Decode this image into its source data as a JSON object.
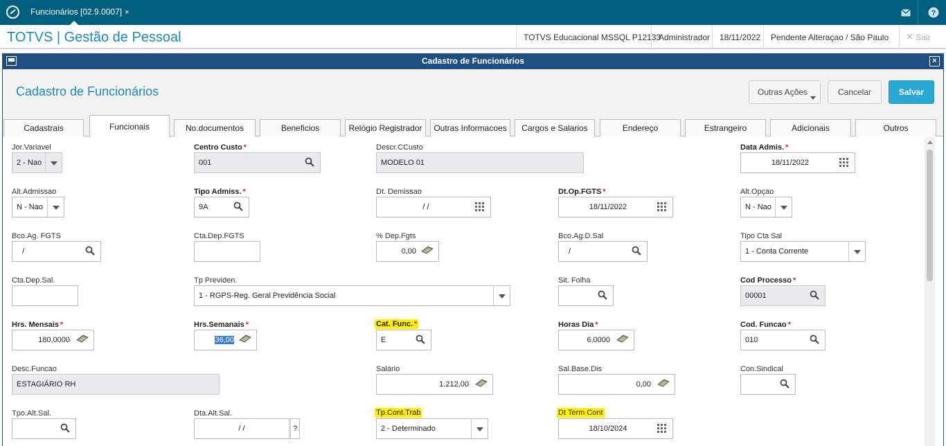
{
  "topbar": {
    "tab_label": "Funcionários [02.9.0007]",
    "tab_close": "×"
  },
  "header": {
    "app_title": "TOTVS | Gestão de Pessoal",
    "environment": "TOTVS Educacional MSSQL P12133",
    "user": "Administrador",
    "date": "18/11/2022",
    "branch": "Pendente Alteraçao / São Paulo",
    "exit_label": "Sair",
    "exit_icon": "×"
  },
  "window": {
    "title": "Cadastro de Funcionários",
    "close": "×"
  },
  "page": {
    "title": "Cadastro de Funcionários",
    "actions_label": "Outras Ações",
    "cancel_label": "Cancelar",
    "save_label": "Salvar"
  },
  "tabs": [
    {
      "label": "Cadastrais"
    },
    {
      "label": "Funcionais"
    },
    {
      "label": "No.documentos"
    },
    {
      "label": "Beneficios"
    },
    {
      "label": "Relógio Registrador"
    },
    {
      "label": "Outras Informacoes"
    },
    {
      "label": "Cargos e Salarios"
    },
    {
      "label": "Endereço"
    },
    {
      "label": "Estrangeiro"
    },
    {
      "label": "Adicionais"
    },
    {
      "label": "Outros"
    }
  ],
  "fields": {
    "jor_variavel": {
      "label": "Jor.Variavel",
      "value": "2 - Nao"
    },
    "centro_custo": {
      "label": "Centro Custo",
      "value": "001"
    },
    "descr_ccusto": {
      "label": "Descr.CCusto",
      "value": "MODELO 01"
    },
    "data_admis": {
      "label": "Data Admis.",
      "value": "18/11/2022"
    },
    "alt_admissao": {
      "label": "Alt.Admissao",
      "value": "N - Nao"
    },
    "tipo_admiss": {
      "label": "Tipo Admiss.",
      "value": "9A"
    },
    "dt_demissao": {
      "label": "Dt. Demissao",
      "value": "/ /"
    },
    "dt_op_fgts": {
      "label": "Dt.Op.FGTS",
      "value": "18/11/2022"
    },
    "alt_opcao": {
      "label": "Alt.Opçao",
      "value": "N - Nao"
    },
    "bco_ag_fgts": {
      "label": "Bco.Ag. FGTS",
      "value": "/"
    },
    "cta_dep_fgts": {
      "label": "Cta.Dep.FGTS",
      "value": ""
    },
    "pct_dep_fgts": {
      "label": "% Dep.Fgts",
      "value": "0,00"
    },
    "bco_ag_d_sal": {
      "label": "Bco.Ag.D.Sal",
      "value": "/"
    },
    "tipo_cta_sal": {
      "label": "Tipo Cta Sal",
      "value": "1 - Conta Corrente"
    },
    "cta_dep_sal": {
      "label": "Cta.Dep.Sal.",
      "value": ""
    },
    "tp_previden": {
      "label": "Tp Previden.",
      "value": "1 - RGPS-Reg. Geral Previdência Social"
    },
    "sit_folha": {
      "label": "Sit. Folha",
      "value": ""
    },
    "cod_processo": {
      "label": "Cod Processo",
      "value": "00001"
    },
    "hrs_mensais": {
      "label": "Hrs. Mensais",
      "value": "180,0000"
    },
    "hrs_semanais": {
      "label": "Hrs.Semanais",
      "value": "36,00"
    },
    "cat_func": {
      "label": "Cat. Func.",
      "value": "E"
    },
    "horas_dia": {
      "label": "Horas Dia",
      "value": "6,0000"
    },
    "cod_funcao": {
      "label": "Cod. Funcao",
      "value": "010"
    },
    "desc_funcao": {
      "label": "Desc.Funcao",
      "value": "ESTAGIÁRIO RH"
    },
    "salario": {
      "label": "Salário",
      "value": "1.212,00"
    },
    "sal_base_dis": {
      "label": "Sal.Base.Dis",
      "value": "0,00"
    },
    "con_sindical": {
      "label": "Con.Sindical",
      "value": ""
    },
    "tpo_alt_sal": {
      "label": "Tpo.Alt.Sal.",
      "value": ""
    },
    "dta_alt_sal": {
      "label": "Dta.Alt.Sal.",
      "value": "/ /",
      "help": "?"
    },
    "tp_cont_trab": {
      "label": "Tp.Cont.Trab",
      "value": "2 - Determinado"
    },
    "dt_term_cont": {
      "label": "Dt Term Cont",
      "value": "18/10/2024"
    }
  },
  "required_marker": "*"
}
